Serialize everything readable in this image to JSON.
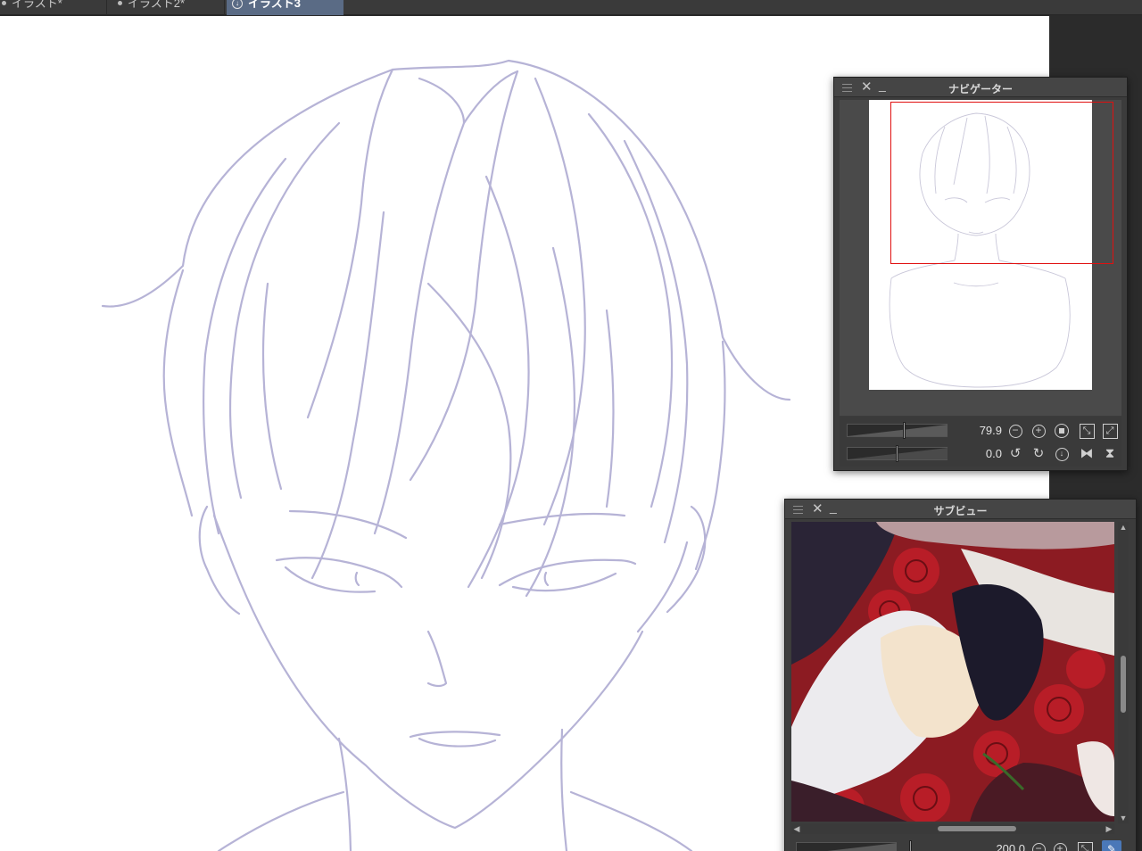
{
  "tabs": [
    {
      "label": "イラスト*",
      "active": false
    },
    {
      "label": "イラスト2*",
      "active": false
    },
    {
      "label": "イラスト3",
      "active": true
    }
  ],
  "navigator": {
    "title": "ナビゲーター",
    "zoom": "79.9",
    "rotation": "0.0"
  },
  "subview": {
    "title": "サブビュー",
    "zoom": "200.0"
  },
  "colors": {
    "sketch_line": "#b6b3d6",
    "active_tab": "#5a6b85",
    "nav_viewport_frame": "#e01010",
    "subview_button": "#4a78b8"
  }
}
